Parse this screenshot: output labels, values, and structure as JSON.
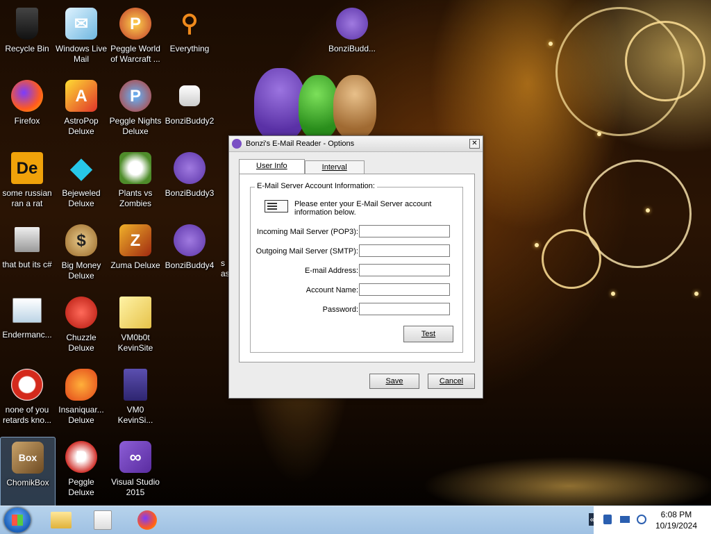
{
  "desktop": {
    "icons": [
      {
        "label": "Recycle Bin",
        "icon": "recycle-bin-icon"
      },
      {
        "label": "Windows Live Mail",
        "icon": "mail-icon"
      },
      {
        "label": "Peggle World of Warcraft ...",
        "icon": "peggle-icon"
      },
      {
        "label": "Everything",
        "icon": "magnifier-icon"
      },
      {
        "label": "BonziBudd...",
        "icon": "bonzi-icon"
      },
      {
        "label": "Firefox",
        "icon": "firefox-icon"
      },
      {
        "label": "AstroPop Deluxe",
        "icon": "astropop-icon"
      },
      {
        "label": "Peggle Nights Deluxe",
        "icon": "peggle-icon"
      },
      {
        "label": "BonziBuddy2",
        "icon": "shortcut-icon"
      },
      {
        "label": "some russian ran a rat",
        "icon": "de-icon"
      },
      {
        "label": "Bejeweled Deluxe",
        "icon": "gem-icon"
      },
      {
        "label": "Plants vs Zombies",
        "icon": "plant-icon"
      },
      {
        "label": "BonziBuddy3",
        "icon": "bonzi-icon"
      },
      {
        "label": "that but its c#",
        "icon": "windows-stack-icon"
      },
      {
        "label": "Big Money Deluxe",
        "icon": "money-bag-icon"
      },
      {
        "label": "Zuma Deluxe",
        "icon": "zuma-icon"
      },
      {
        "label": "BonziBuddy4",
        "icon": "bonzi-icon"
      },
      {
        "label": "Endermanc...",
        "icon": "window-icon"
      },
      {
        "label": "Chuzzle Deluxe",
        "icon": "chuzzle-icon"
      },
      {
        "label": "VM0b0t KevinSite",
        "icon": "globe-folder-icon"
      },
      {
        "label": "none of you retards kno...",
        "icon": "dragon-icon"
      },
      {
        "label": "Insaniquar... Deluxe",
        "icon": "fish-icon"
      },
      {
        "label": "VM0 KevinSi...",
        "icon": "firefox-file-icon"
      },
      {
        "label": "ChomikBox",
        "icon": "chomikbox-icon"
      },
      {
        "label": "Peggle Deluxe",
        "icon": "peggle-icon"
      },
      {
        "label": "Visual Studio 2015",
        "icon": "visual-studio-icon"
      }
    ],
    "partial_label": "s as"
  },
  "dialog": {
    "title": "Bonzi's E-Mail Reader - Options",
    "close": "✕",
    "tabs": [
      "User Info",
      "Interval"
    ],
    "group_label": "E-Mail Server Account Information:",
    "info_text": "Please enter your E-Mail Server account information below.",
    "fields": [
      {
        "label": "Incoming Mail Server (POP3):",
        "value": ""
      },
      {
        "label": "Outgoing Mail Server (SMTP):",
        "value": ""
      },
      {
        "label": "E-mail Address:",
        "value": ""
      },
      {
        "label": "Account Name:",
        "value": ""
      },
      {
        "label": "Password:",
        "value": ""
      }
    ],
    "test_button": "Test",
    "save_button": "Save",
    "cancel_button": "Cancel"
  },
  "taskbar": {
    "items": [
      "explorer-icon",
      "media-player-icon",
      "firefox-icon"
    ],
    "tray_expand": "«",
    "time": "6:08 PM",
    "date": "10/19/2024"
  },
  "colors": {
    "taskbar": "#a9c9e8",
    "dialog_bg": "#ececec",
    "bonzi_purple": "#7a4fc4"
  }
}
